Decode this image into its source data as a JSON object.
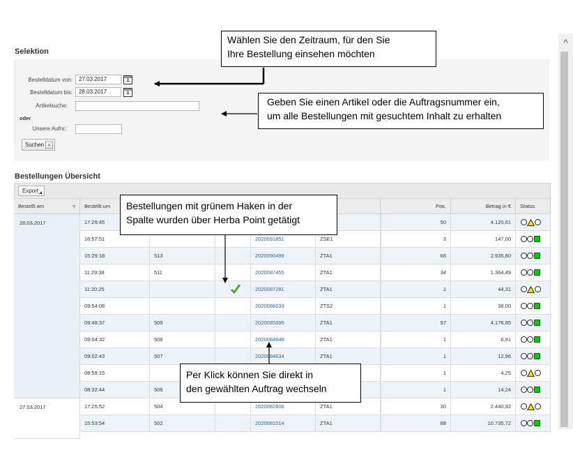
{
  "selection": {
    "title": "Selektion",
    "date_from_label": "Bestelldatum von:",
    "date_from_value": "27.03.2017",
    "date_to_label": "Bestelldatum bis:",
    "date_to_value": "28.03.2017",
    "calendar_glyph": "1",
    "article_label": "Artikelsuche:",
    "article_value": "",
    "or_label": "oder",
    "order_label": "Unsere Aufnr.:",
    "order_value": "",
    "search_button": "Suchen",
    "search_chevron": "›"
  },
  "overview": {
    "title": "Bestellungen Übersicht",
    "export_button": "Export",
    "columns": [
      "Bestellt am",
      "Bestellt um",
      "",
      "",
      "",
      "",
      "Pos.",
      "Betrag in €",
      "Status"
    ],
    "sort_icon": "▿",
    "groups": [
      {
        "date": "28.03.2017"
      },
      {
        "date": "27.03.2017"
      }
    ],
    "rows": [
      {
        "time": "17:29:45",
        "ref": "",
        "herba": false,
        "order": "",
        "type": "",
        "pos": "50",
        "amount": "4.120,61",
        "status": "yellow"
      },
      {
        "time": "16:57:51",
        "ref": "",
        "herba": false,
        "order": "2020091851",
        "type": "ZSE1",
        "pos": "3",
        "amount": "147,00",
        "status": "green"
      },
      {
        "time": "15:29:18",
        "ref": "513",
        "herba": false,
        "order": "2020090499",
        "type": "ZTA1",
        "pos": "66",
        "amount": "2.935,80",
        "status": "green"
      },
      {
        "time": "11:29:38",
        "ref": "511",
        "herba": false,
        "order": "2020087455",
        "type": "ZTA1",
        "pos": "34",
        "amount": "1.364,49",
        "status": "green"
      },
      {
        "time": "11:20:25",
        "ref": "",
        "herba": true,
        "order": "2020087281",
        "type": "ZTA1",
        "pos": "1",
        "amount": "44,31",
        "status": "yellow"
      },
      {
        "time": "09:54:08",
        "ref": "",
        "herba": false,
        "order": "2020086033",
        "type": "ZTS2",
        "pos": "1",
        "amount": "38,00",
        "status": "green"
      },
      {
        "time": "09:48:37",
        "ref": "509",
        "herba": false,
        "order": "2020085895",
        "type": "ZTA1",
        "pos": "97",
        "amount": "4.176,85",
        "status": "green"
      },
      {
        "time": "09:04:32",
        "ref": "508",
        "herba": false,
        "order": "2020084648",
        "type": "ZTA1",
        "pos": "1",
        "amount": "6,91",
        "status": "green"
      },
      {
        "time": "09:02:43",
        "ref": "507",
        "herba": false,
        "order": "2020084634",
        "type": "ZTA1",
        "pos": "1",
        "amount": "12,96",
        "status": "green"
      },
      {
        "time": "08:59:15",
        "ref": "",
        "herba": false,
        "order": "",
        "type": "",
        "pos": "1",
        "amount": "4,25",
        "status": "yellow"
      },
      {
        "time": "08:32:44",
        "ref": "506",
        "herba": false,
        "order": "",
        "type": "",
        "pos": "1",
        "amount": "14,24",
        "status": "green"
      },
      {
        "time": "17:25:52",
        "ref": "504",
        "herba": false,
        "order": "2020082606",
        "type": "ZTA1",
        "pos": "30",
        "amount": "2.440,92",
        "status": "yellow"
      },
      {
        "time": "15:53:54",
        "ref": "502",
        "herba": false,
        "order": "2020081514",
        "type": "ZTA1",
        "pos": "88",
        "amount": "10.735,72",
        "status": "green"
      }
    ]
  },
  "callouts": {
    "timeframe_1": "Wählen Sie den Zeitraum, für den Sie",
    "timeframe_2": "Ihre Bestellung einsehen möchten",
    "article_1": "Geben Sie einen Artikel oder die Auftragsnummer ein,",
    "article_2": "um alle Bestellungen mit gesuchtem Inhalt zu erhalten",
    "herba_1": "Bestellungen mit grünem Haken in der",
    "herba_2": "Spalte wurden über Herba Point getätigt",
    "click_1": "Per Klick können Sie direkt in",
    "click_2": "den gewählten Auftrag wechseln"
  },
  "scrollbar": {
    "up_glyph": "^"
  },
  "colors": {
    "link": "#2b63a6",
    "status_green": "#11c40f",
    "status_yellow": "#f2e400",
    "check": "#5aa43c",
    "alt_row": "#edf3f9"
  }
}
